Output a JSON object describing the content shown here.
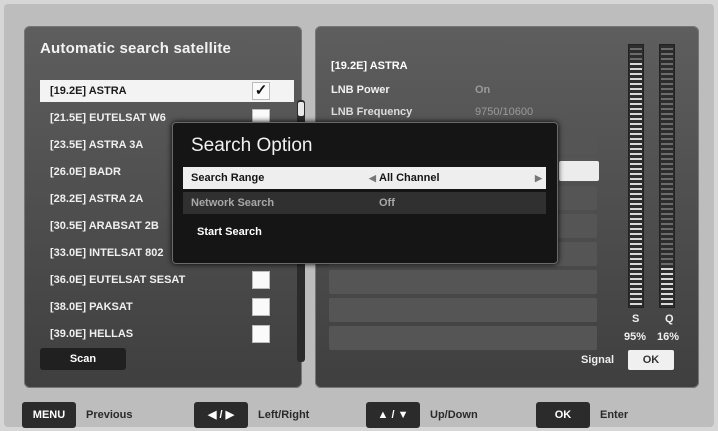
{
  "left_panel": {
    "title": "Automatic search satellite",
    "satellites": [
      {
        "label": "[19.2E] ASTRA",
        "checked": true,
        "selected": true
      },
      {
        "label": "[21.5E] EUTELSAT W6",
        "checked": false
      },
      {
        "label": "[23.5E] ASTRA 3A",
        "checked": false
      },
      {
        "label": "[26.0E] BADR",
        "checked": false
      },
      {
        "label": "[28.2E] ASTRA 2A",
        "checked": false
      },
      {
        "label": "[30.5E] ARABSAT 2B",
        "checked": false
      },
      {
        "label": "[33.0E] INTELSAT 802",
        "checked": false
      },
      {
        "label": "[36.0E] EUTELSAT SESAT",
        "checked": false
      },
      {
        "label": "[38.0E] PAKSAT",
        "checked": false
      },
      {
        "label": "[39.0E] HELLAS",
        "checked": false
      }
    ],
    "check_mark": "✓",
    "scan_label": "Scan"
  },
  "right_panel": {
    "satellite_title": "[19.2E] ASTRA",
    "lnb_power_label": "LNB Power",
    "lnb_power_value": "On",
    "lnb_frequency_label": "LNB Frequency",
    "lnb_frequency_value": "9750/10600",
    "signal_label": "Signal",
    "signal_value": "OK",
    "strength_label": "S",
    "strength_value": "95%",
    "quality_label": "Q",
    "quality_value": "16%"
  },
  "dialog": {
    "title": "Search Option",
    "rows": [
      {
        "label": "Search Range",
        "value": "All Channel",
        "selected": true
      },
      {
        "label": "Network Search",
        "value": "Off",
        "selected": false
      }
    ],
    "start_label": "Start Search",
    "arrow_left": "◀",
    "arrow_right": "▶"
  },
  "footer": {
    "menu_label": "MENU",
    "menu_action": "Previous",
    "leftright_label": "◀ / ▶",
    "leftright_action": "Left/Right",
    "updown_label": "▲ / ▼",
    "updown_action": "Up/Down",
    "ok_label": "OK",
    "ok_action": "Enter"
  }
}
